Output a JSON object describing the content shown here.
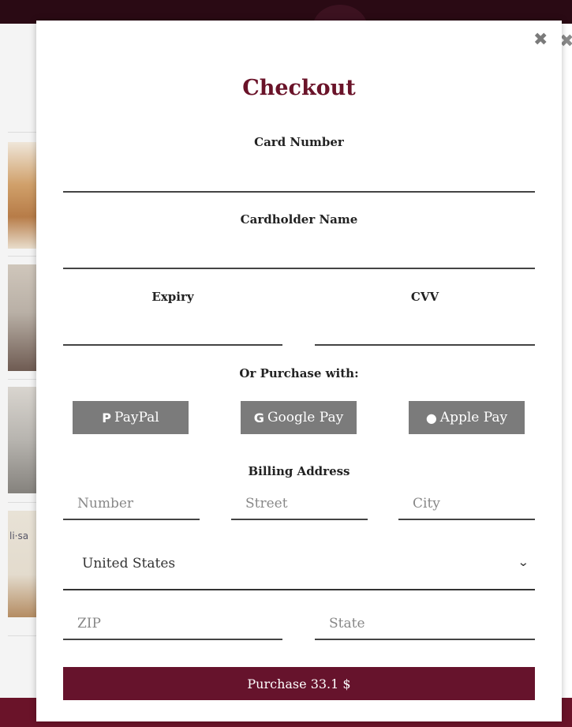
{
  "modal": {
    "title": "Checkout",
    "close_icon": "close-icon"
  },
  "card": {
    "number_label": "Card Number",
    "name_label": "Cardholder Name",
    "expiry_label": "Expiry",
    "cvv_label": "CVV"
  },
  "alt_payment": {
    "label": "Or Purchase with:",
    "paypal": "PayPal",
    "paypal_icon": "paypal-icon",
    "google": "Google Pay",
    "google_icon": "google-icon",
    "apple": "Apple Pay",
    "apple_icon": "apple-icon"
  },
  "billing": {
    "label": "Billing Address",
    "number_placeholder": "Number",
    "street_placeholder": "Street",
    "city_placeholder": "City",
    "country_value": "United States",
    "zip_placeholder": "ZIP",
    "state_placeholder": "State"
  },
  "purchase": {
    "label": "Purchase 33.1 $"
  },
  "background": {
    "sidebar_text": "li·sa"
  },
  "colors": {
    "accent": "#6a1329",
    "button_gray": "#7b7b7b"
  }
}
